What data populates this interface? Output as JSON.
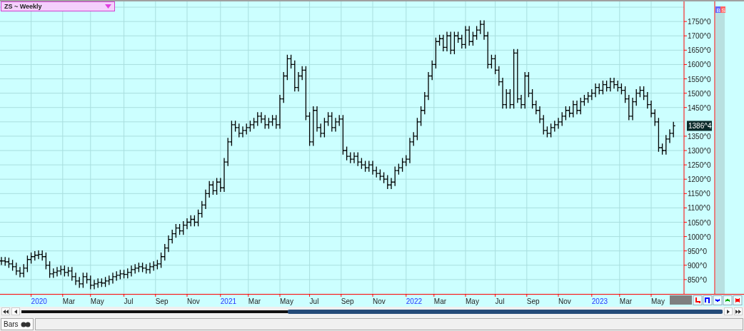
{
  "chart_title": {
    "text": "ZS ~ Weekly"
  },
  "side_buttons": [
    {
      "label": "B",
      "color": "#6666ff"
    },
    {
      "label": "S",
      "color": "#ff6666"
    }
  ],
  "last_price": {
    "label": "1386^4"
  },
  "price_axis": {
    "labels": [
      "1750^0",
      "1700^0",
      "1650^0",
      "1600^0",
      "1550^0",
      "1500^0",
      "1450^0",
      "1350^0",
      "1300^0",
      "1250^0",
      "1200^0",
      "1150^0",
      "1100^0",
      "1050^0",
      "1000^0",
      "950^0",
      "900^0",
      "850^0"
    ]
  },
  "date_axis": {
    "labels": [
      {
        "text": "2020",
        "kind": "year"
      },
      {
        "text": "Mar",
        "kind": "month"
      },
      {
        "text": "May",
        "kind": "month"
      },
      {
        "text": "Jul",
        "kind": "month"
      },
      {
        "text": "Sep",
        "kind": "month"
      },
      {
        "text": "Nov",
        "kind": "month"
      },
      {
        "text": "2021",
        "kind": "year"
      },
      {
        "text": "Mar",
        "kind": "month"
      },
      {
        "text": "May",
        "kind": "month"
      },
      {
        "text": "Jul",
        "kind": "month"
      },
      {
        "text": "Sep",
        "kind": "month"
      },
      {
        "text": "Nov",
        "kind": "month"
      },
      {
        "text": "2022",
        "kind": "year"
      },
      {
        "text": "Mar",
        "kind": "month"
      },
      {
        "text": "May",
        "kind": "month"
      },
      {
        "text": "Jul",
        "kind": "month"
      },
      {
        "text": "Sep",
        "kind": "month"
      },
      {
        "text": "Nov",
        "kind": "month"
      },
      {
        "text": "2023",
        "kind": "year"
      },
      {
        "text": "Mar",
        "kind": "month"
      },
      {
        "text": "May",
        "kind": "month"
      }
    ]
  },
  "draw_tools": [
    {
      "color": "#ff0000"
    },
    {
      "color": "#0000ff"
    },
    {
      "color": "#0000ff"
    },
    {
      "color": "#00aa00"
    },
    {
      "color": "#ff0000"
    }
  ],
  "tabs": [
    {
      "label": "Bars",
      "selected": true
    }
  ]
}
